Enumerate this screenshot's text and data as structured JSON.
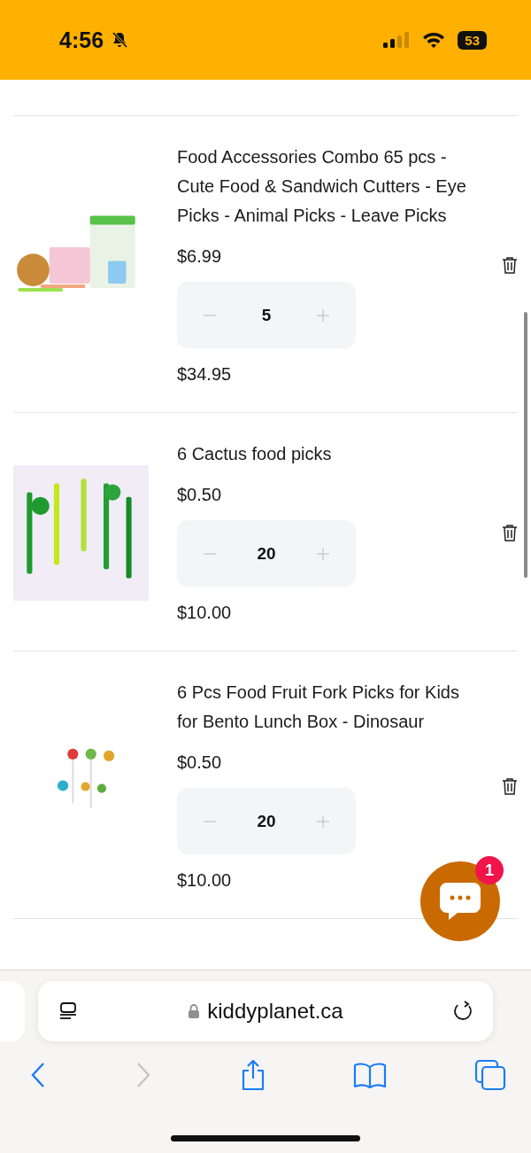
{
  "status_bar": {
    "time": "4:56",
    "silent": true,
    "battery": "53"
  },
  "cart_items": [
    {
      "title": "Food Accessories Combo 65 pcs - Cute Food & Sandwich Cutters - Eye Picks - Animal Picks - Leave Picks",
      "price": "$6.99",
      "quantity": "5",
      "line_total": "$34.95"
    },
    {
      "title": "6 Cactus food picks",
      "price": "$0.50",
      "quantity": "20",
      "line_total": "$10.00"
    },
    {
      "title": "6 Pcs Food Fruit Fork Picks for Kids for Bento Lunch Box - Dinosaur",
      "price": "$0.50",
      "quantity": "20",
      "line_total": "$10.00"
    }
  ],
  "chat_widget": {
    "badge": "1"
  },
  "browser": {
    "url": "kiddyplanet.ca",
    "back_enabled": true,
    "forward_enabled": false
  }
}
